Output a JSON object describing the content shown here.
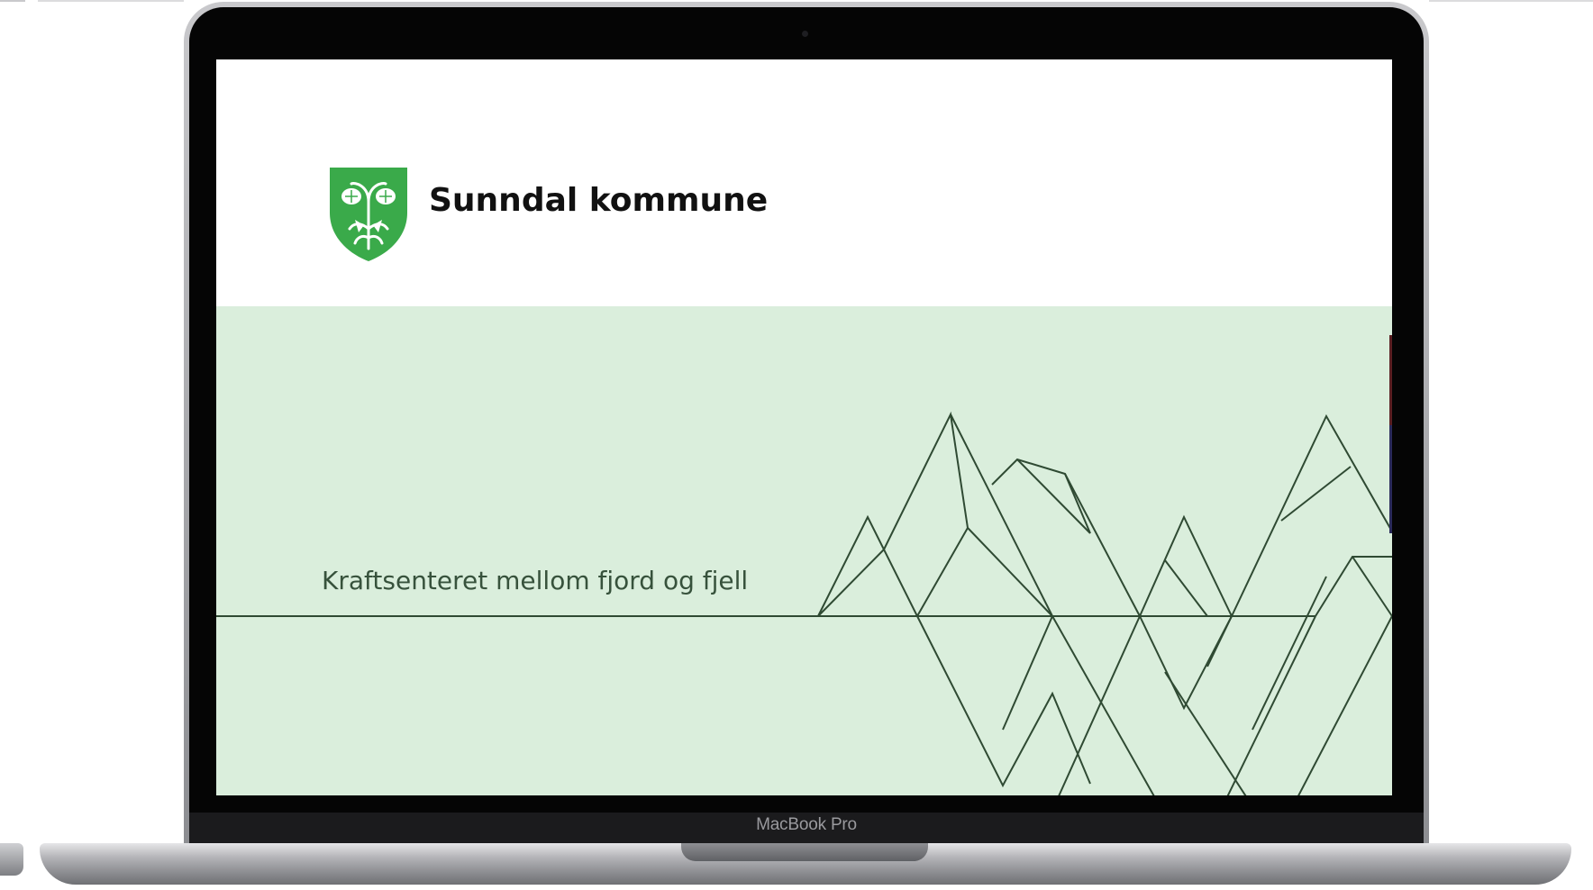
{
  "device": {
    "brand_label": "MacBook Pro"
  },
  "site": {
    "name": "Sunndal kommune",
    "crest_icon": "coat-of-arms-icon",
    "crest_color": "#3aaa4a"
  },
  "hero": {
    "tagline": "Kraftsenteret mellom fjord og fjell",
    "background_color": "#daeedc",
    "line_color": "#2f4a33",
    "decoration_icon": "mountain-line-art"
  }
}
